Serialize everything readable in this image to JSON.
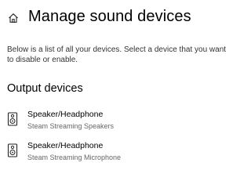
{
  "header": {
    "title": "Manage sound devices",
    "icon": "home-icon"
  },
  "description": "Below is a list of all your devices. Select a device that you want to disable or enable.",
  "output_section": {
    "title": "Output devices",
    "devices": [
      {
        "name": "Speaker/Headphone",
        "subtitle": "Steam Streaming Speakers",
        "icon": "speaker-icon"
      },
      {
        "name": "Speaker/Headphone",
        "subtitle": "Steam Streaming Microphone",
        "icon": "speaker-icon"
      }
    ]
  }
}
